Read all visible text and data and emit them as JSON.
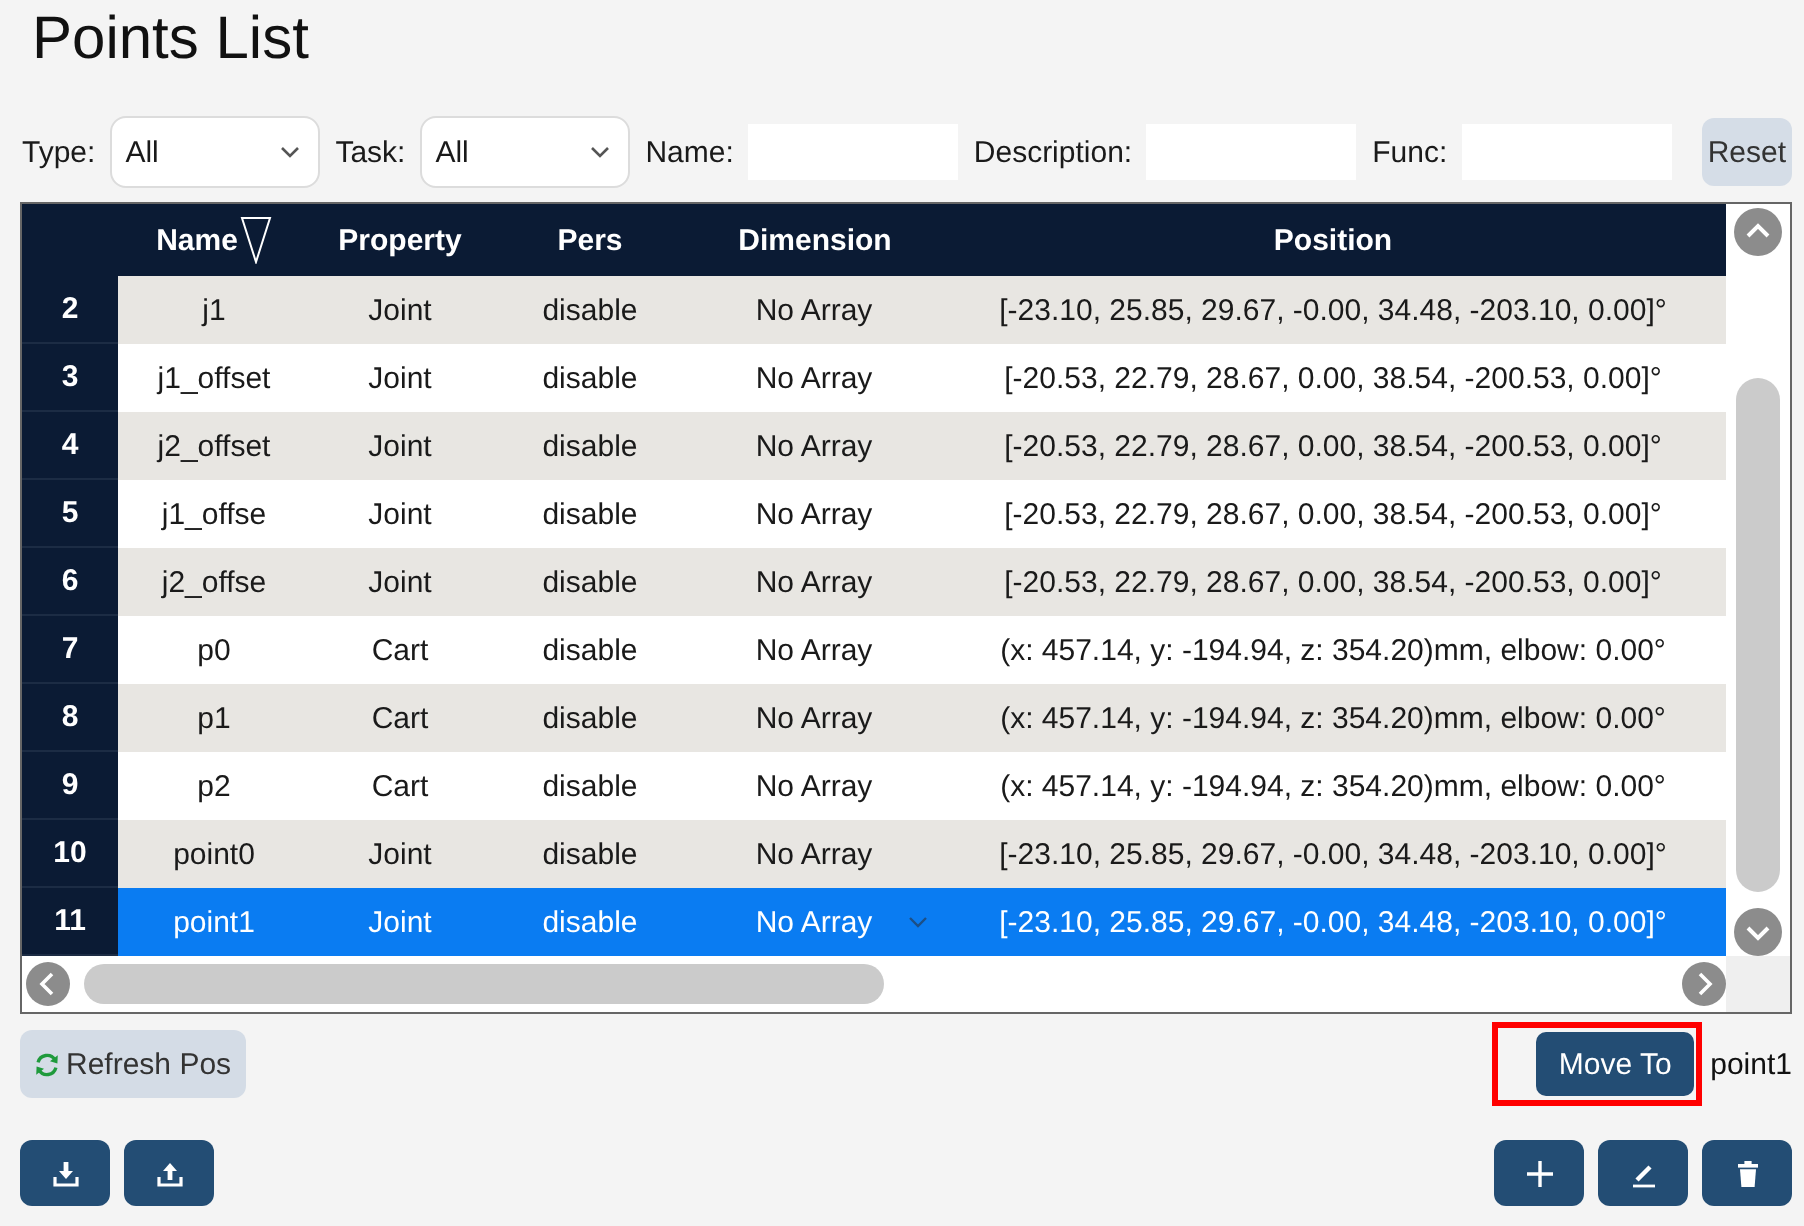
{
  "title": "Points List",
  "filters": [
    {
      "kind": "select",
      "label": "Type:",
      "value": "All"
    },
    {
      "kind": "select",
      "label": "Task:",
      "value": "All"
    },
    {
      "kind": "text",
      "label": "Name:"
    },
    {
      "kind": "text",
      "label": "Description:"
    },
    {
      "kind": "text",
      "label": "Func:"
    }
  ],
  "reset_button": "Reset",
  "table": {
    "columns": [
      {
        "label": "Name",
        "sorted": true
      },
      {
        "label": "Property",
        "sorted": false
      },
      {
        "label": "Pers",
        "sorted": false
      },
      {
        "label": "Dimension",
        "sorted": false
      },
      {
        "label": "Position",
        "sorted": false
      }
    ],
    "rows": [
      {
        "number": "2",
        "cells": [
          "j1",
          "Joint",
          "disable",
          "No Array",
          "[-23.10, 25.85, 29.67, -0.00, 34.48, -203.10, 0.00]°"
        ],
        "selected": false
      },
      {
        "number": "3",
        "cells": [
          "j1_offset",
          "Joint",
          "disable",
          "No Array",
          "[-20.53, 22.79, 28.67, 0.00, 38.54, -200.53, 0.00]°"
        ],
        "selected": false
      },
      {
        "number": "4",
        "cells": [
          "j2_offset",
          "Joint",
          "disable",
          "No Array",
          "[-20.53, 22.79, 28.67, 0.00, 38.54, -200.53, 0.00]°"
        ],
        "selected": false
      },
      {
        "number": "5",
        "cells": [
          "j1_offse",
          "Joint",
          "disable",
          "No Array",
          "[-20.53, 22.79, 28.67, 0.00, 38.54, -200.53, 0.00]°"
        ],
        "selected": false
      },
      {
        "number": "6",
        "cells": [
          "j2_offse",
          "Joint",
          "disable",
          "No Array",
          "[-20.53, 22.79, 28.67, 0.00, 38.54, -200.53, 0.00]°"
        ],
        "selected": false
      },
      {
        "number": "7",
        "cells": [
          "p0",
          "Cart",
          "disable",
          "No Array",
          "(x: 457.14, y: -194.94, z: 354.20)mm, elbow: 0.00°"
        ],
        "selected": false
      },
      {
        "number": "8",
        "cells": [
          "p1",
          "Cart",
          "disable",
          "No Array",
          "(x: 457.14, y: -194.94, z: 354.20)mm, elbow: 0.00°"
        ],
        "selected": false
      },
      {
        "number": "9",
        "cells": [
          "p2",
          "Cart",
          "disable",
          "No Array",
          "(x: 457.14, y: -194.94, z: 354.20)mm, elbow: 0.00°"
        ],
        "selected": false
      },
      {
        "number": "10",
        "cells": [
          "point0",
          "Joint",
          "disable",
          "No Array",
          "[-23.10, 25.85, 29.67, -0.00, 34.48, -203.10, 0.00]°"
        ],
        "selected": false
      },
      {
        "number": "11",
        "cells": [
          "point1",
          "Joint",
          "disable",
          "No Array",
          "[-23.10, 25.85, 29.67, -0.00, 34.48, -203.10, 0.00]°"
        ],
        "selected": true
      }
    ]
  },
  "refresh_button": "Refresh Pos",
  "move_to": {
    "label": "Move To",
    "highlighted": true
  },
  "current_point": "point1",
  "left_actions": [
    {
      "kind": "download"
    },
    {
      "kind": "upload"
    }
  ],
  "right_actions": [
    {
      "kind": "add"
    },
    {
      "kind": "edit"
    },
    {
      "kind": "delete"
    }
  ]
}
